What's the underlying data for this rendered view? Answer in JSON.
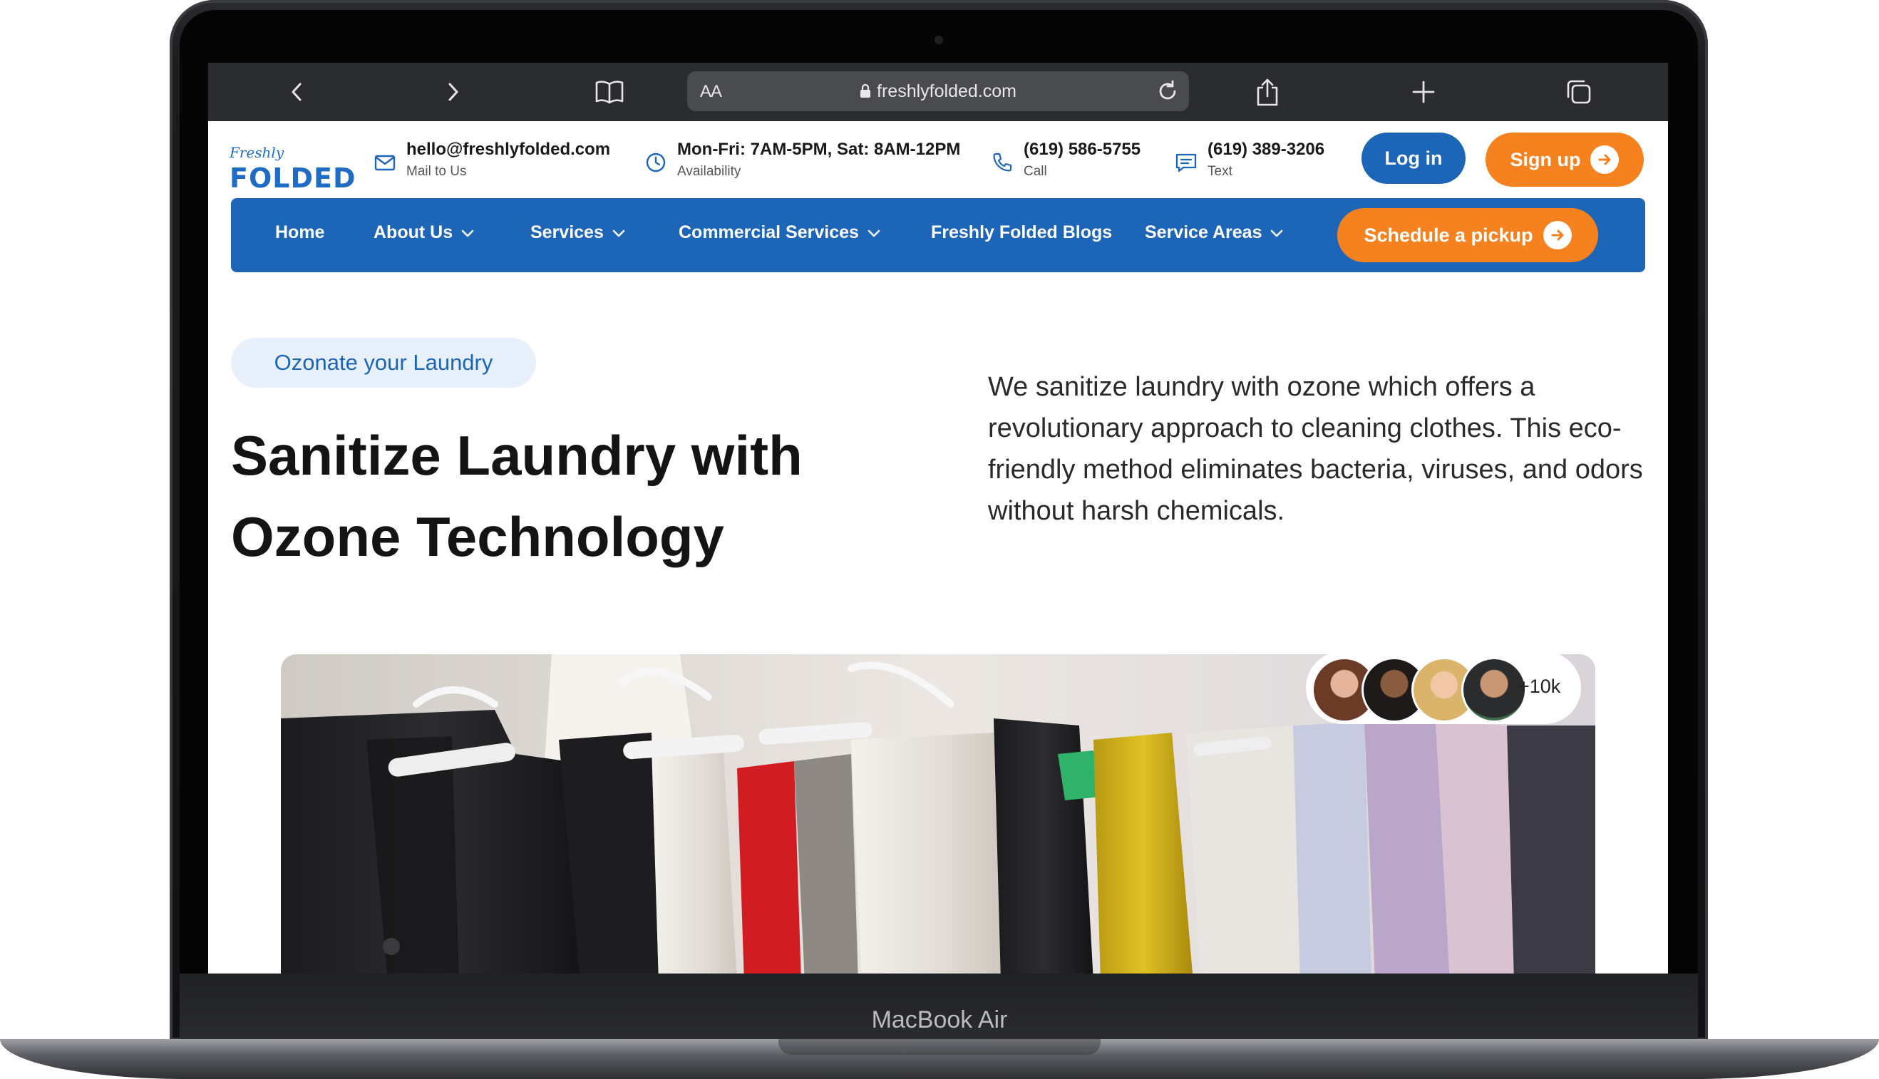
{
  "device": {
    "model_label": "MacBook Air"
  },
  "browser": {
    "url": "freshlyfolded.com",
    "reader_label": "AA",
    "icons": [
      "chevron-left-icon",
      "chevron-right-icon",
      "book-icon",
      "lock-icon",
      "reload-icon",
      "share-icon",
      "plus-icon",
      "tabs-icon"
    ]
  },
  "site": {
    "logo": {
      "script": "Freshly",
      "word": "FOLDED"
    },
    "contact": {
      "email": {
        "value": "hello@freshlyfolded.com",
        "sub": "Mail to Us",
        "icon": "mail-icon"
      },
      "hours": {
        "value": "Mon-Fri: 7AM-5PM, Sat: 8AM-12PM",
        "sub": "Availability",
        "icon": "clock-icon"
      },
      "call": {
        "value": "(619) 586-5755",
        "sub": "Call",
        "icon": "phone-icon"
      },
      "text": {
        "value": "(619) 389-3206",
        "sub": "Text",
        "icon": "message-icon"
      }
    },
    "auth": {
      "login": "Log in",
      "signup": "Sign up"
    },
    "nav": {
      "items": [
        {
          "label": "Home",
          "dropdown": false
        },
        {
          "label": "About Us",
          "dropdown": true
        },
        {
          "label": "Services",
          "dropdown": true
        },
        {
          "label": "Commercial Services",
          "dropdown": true
        },
        {
          "label": "Freshly Folded Blogs",
          "dropdown": false
        },
        {
          "label": "Service Areas",
          "dropdown": true
        }
      ],
      "cta": "Schedule a pickup"
    },
    "hero": {
      "tag": "Ozonate your Laundry",
      "title_line1": "Sanitize Laundry with",
      "title_line2": "Ozone Technology",
      "description": "We sanitize laundry with ozone which offers a revolutionary approach to cleaning clothes. This eco-friendly method eliminates bacteria, viruses, and odors without harsh chemicals.",
      "social_proof": "+10k"
    }
  },
  "colors": {
    "brand_blue": "#1c65b7",
    "accent_orange": "#f5821f"
  }
}
